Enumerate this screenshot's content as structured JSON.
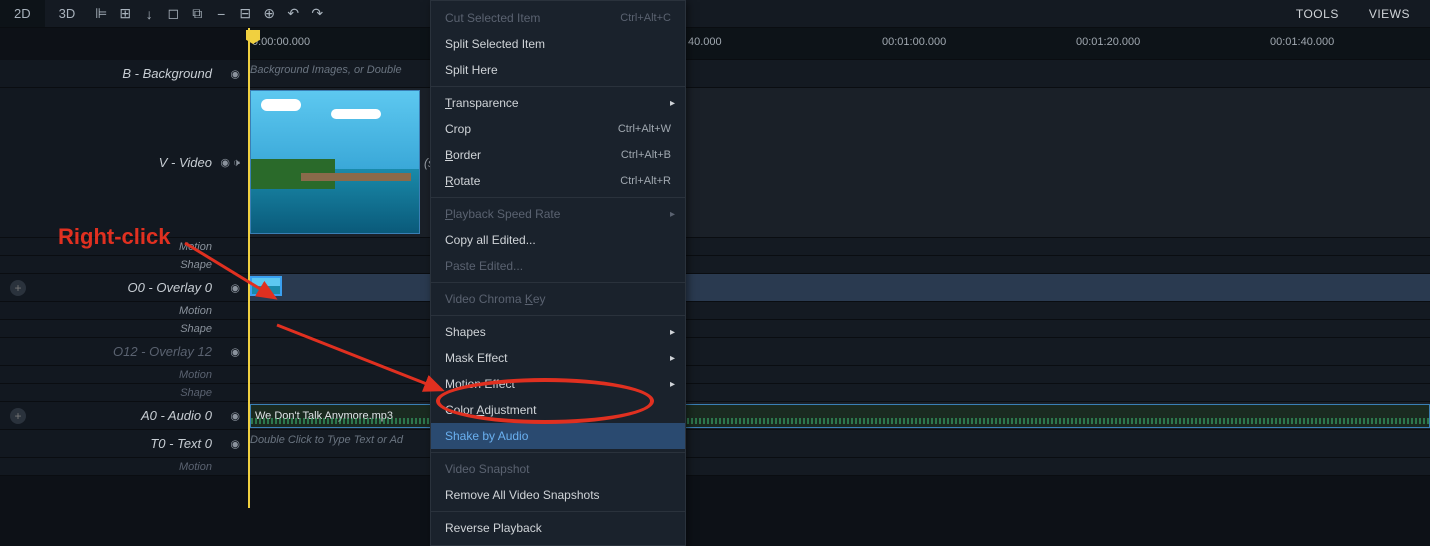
{
  "toolbar": {
    "tabs": {
      "2d": "2D",
      "3d": "3D"
    },
    "right": {
      "tools": "TOOLS",
      "views": "VIEWS"
    }
  },
  "ruler": {
    "marks": [
      {
        "pos": 4,
        "label": "0:00:00.000"
      },
      {
        "pos": 440,
        "label": "40.000"
      },
      {
        "pos": 634,
        "label": "00:01:00.000"
      },
      {
        "pos": 828,
        "label": "00:01:20.000"
      },
      {
        "pos": 1022,
        "label": "00:01:40.000"
      }
    ]
  },
  "tracks": {
    "background": {
      "label": "B - Background",
      "placeholder": "Background Images, or Double"
    },
    "video": {
      "label": "V - Video",
      "truncated": "(str",
      "sub1": "Motion",
      "sub2": "Shape"
    },
    "overlay0": {
      "label": "O0 - Overlay 0",
      "sub1": "Motion",
      "sub2": "Shape"
    },
    "overlay12": {
      "label": "O12 - Overlay 12",
      "sub1": "Motion",
      "sub2": "Shape"
    },
    "audio0": {
      "label": "A0 - Audio 0",
      "clip": "We Don't Talk Anymore.mp3"
    },
    "text0": {
      "label": "T0 - Text 0",
      "sub1": "Motion",
      "placeholder": "Double Click to Type Text or Ad"
    }
  },
  "context_menu": {
    "items": [
      {
        "label": "Cut Selected Item",
        "shortcut": "Ctrl+Alt+C",
        "disabled": true
      },
      {
        "label": "Split Selected Item"
      },
      {
        "label": "Split Here"
      },
      {
        "sep": true
      },
      {
        "label": "Transparence",
        "underline": 0,
        "submenu": true
      },
      {
        "label": "Crop",
        "shortcut": "Ctrl+Alt+W"
      },
      {
        "label": "Border",
        "underline": 0,
        "shortcut": "Ctrl+Alt+B"
      },
      {
        "label": "Rotate",
        "underline": 0,
        "shortcut": "Ctrl+Alt+R"
      },
      {
        "sep": true
      },
      {
        "label": "Playback Speed Rate",
        "underline": 0,
        "submenu": true,
        "disabled": true
      },
      {
        "label": "Copy all Edited..."
      },
      {
        "label": "Paste Edited...",
        "disabled": true
      },
      {
        "sep": true
      },
      {
        "label": "Video Chroma Key",
        "underline": 13,
        "disabled": true
      },
      {
        "sep": true
      },
      {
        "label": "Shapes",
        "submenu": true
      },
      {
        "label": "Mask Effect",
        "submenu": true
      },
      {
        "label": "Motion Effect",
        "submenu": true
      },
      {
        "label": "Color Adjustment",
        "underline": 6
      },
      {
        "label": "Shake by Audio",
        "highlighted": true
      },
      {
        "sep": true
      },
      {
        "label": "Video Snapshot",
        "disabled": true
      },
      {
        "label": "Remove All Video Snapshots"
      },
      {
        "sep": true
      },
      {
        "label": "Reverse Playback"
      }
    ]
  },
  "annotation": {
    "text": "Right-click"
  }
}
